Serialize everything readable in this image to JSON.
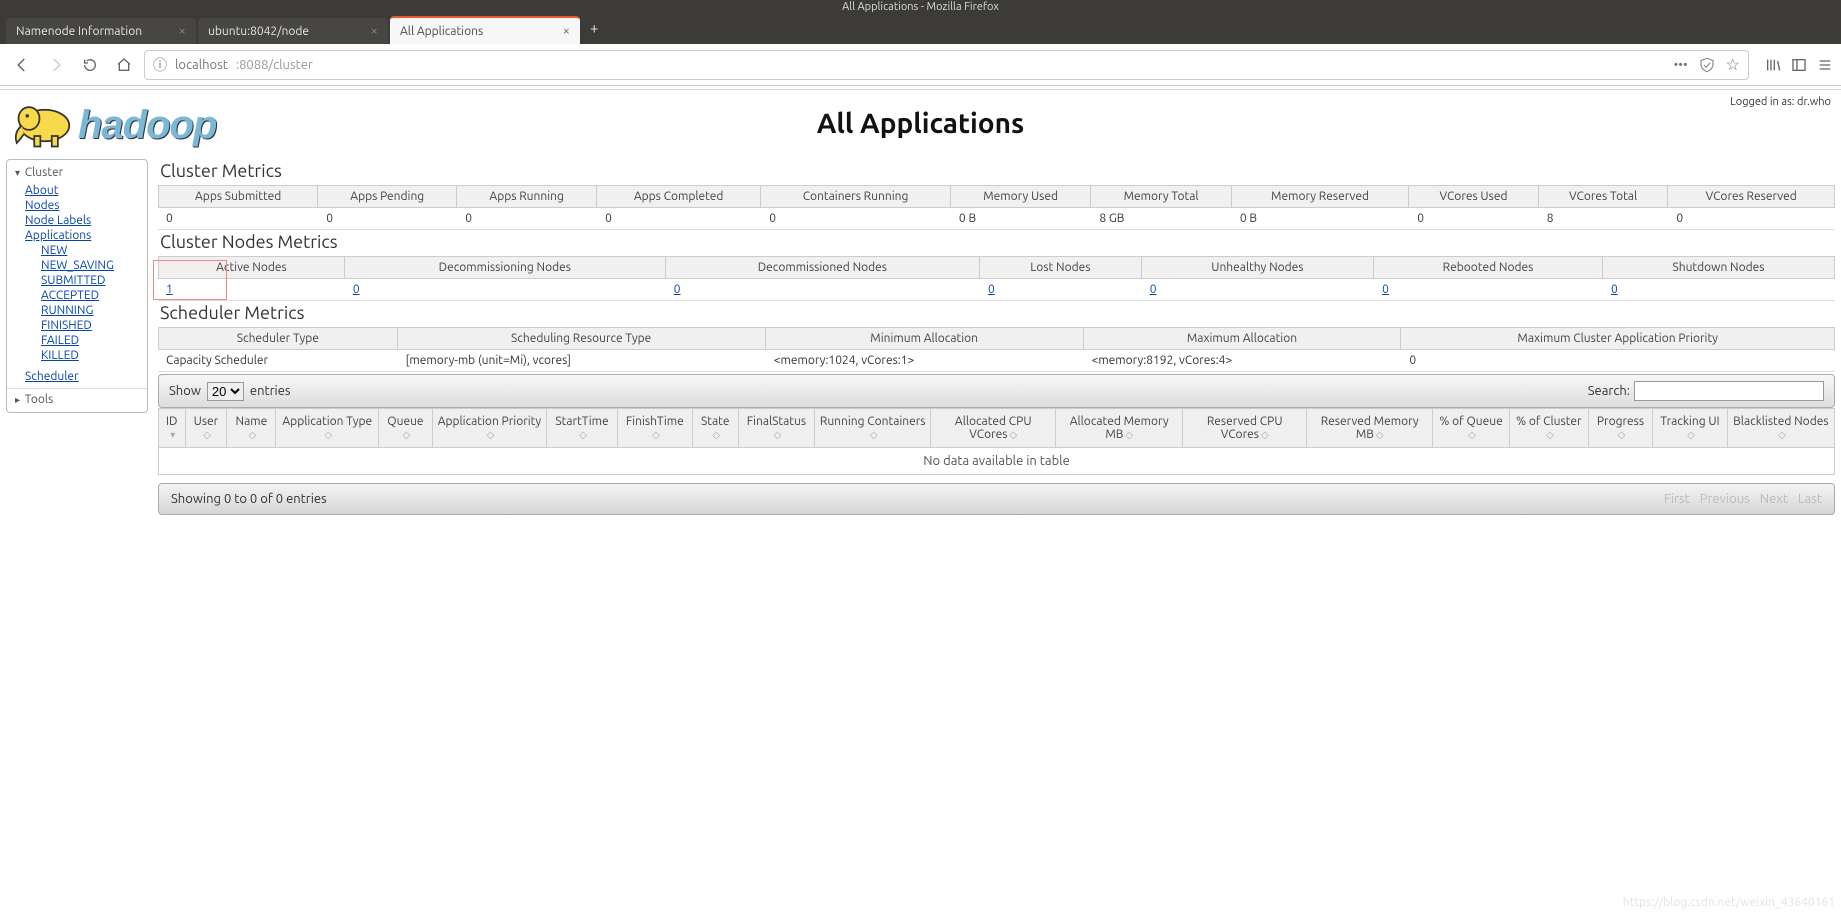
{
  "window": {
    "title": "All Applications - Mozilla Firefox"
  },
  "tabs": [
    {
      "label": "Namenode Information"
    },
    {
      "label": "ubuntu:8042/node"
    },
    {
      "label": "All Applications",
      "active": true
    }
  ],
  "url": {
    "host": "localhost",
    "port_path": ":8088/cluster"
  },
  "login_status": "Logged in as: dr.who",
  "page_title": "All Applications",
  "sidebar": {
    "sections": [
      {
        "label": "Cluster",
        "open": true
      },
      {
        "label": "Tools",
        "open": false
      }
    ],
    "cluster_links": [
      "About",
      "Nodes",
      "Node Labels",
      "Applications"
    ],
    "application_states": [
      "NEW",
      "NEW_SAVING",
      "SUBMITTED",
      "ACCEPTED",
      "RUNNING",
      "FINISHED",
      "FAILED",
      "KILLED"
    ],
    "scheduler_link": "Scheduler"
  },
  "cluster_metrics": {
    "title": "Cluster Metrics",
    "headers": [
      "Apps Submitted",
      "Apps Pending",
      "Apps Running",
      "Apps Completed",
      "Containers Running",
      "Memory Used",
      "Memory Total",
      "Memory Reserved",
      "VCores Used",
      "VCores Total",
      "VCores Reserved"
    ],
    "values": [
      "0",
      "0",
      "0",
      "0",
      "0",
      "0 B",
      "8 GB",
      "0 B",
      "0",
      "8",
      "0"
    ]
  },
  "nodes_metrics": {
    "title": "Cluster Nodes Metrics",
    "headers": [
      "Active Nodes",
      "Decommissioning Nodes",
      "Decommissioned Nodes",
      "Lost Nodes",
      "Unhealthy Nodes",
      "Rebooted Nodes",
      "Shutdown Nodes"
    ],
    "values": [
      "1",
      "0",
      "0",
      "0",
      "0",
      "0",
      "0"
    ]
  },
  "scheduler_metrics": {
    "title": "Scheduler Metrics",
    "headers": [
      "Scheduler Type",
      "Scheduling Resource Type",
      "Minimum Allocation",
      "Maximum Allocation",
      "Maximum Cluster Application Priority"
    ],
    "values": [
      "Capacity Scheduler",
      "[memory-mb (unit=Mi), vcores]",
      "<memory:1024, vCores:1>",
      "<memory:8192, vCores:4>",
      "0"
    ]
  },
  "apps_table": {
    "show_label_pre": "Show",
    "show_label_post": "entries",
    "show_value": "20",
    "search_label": "Search:",
    "headers": [
      "ID",
      "User",
      "Name",
      "Application Type",
      "Queue",
      "Application Priority",
      "StartTime",
      "FinishTime",
      "State",
      "FinalStatus",
      "Running Containers",
      "Allocated CPU VCores",
      "Allocated Memory MB",
      "Reserved CPU VCores",
      "Reserved Memory MB",
      "% of Queue",
      "% of Cluster",
      "Progress",
      "Tracking UI",
      "Blacklisted Nodes"
    ],
    "no_data": "No data available in table",
    "info": "Showing 0 to 0 of 0 entries",
    "pager": [
      "First",
      "Previous",
      "Next",
      "Last"
    ]
  },
  "watermark": "https://blog.csdn.net/weixin_43640161"
}
